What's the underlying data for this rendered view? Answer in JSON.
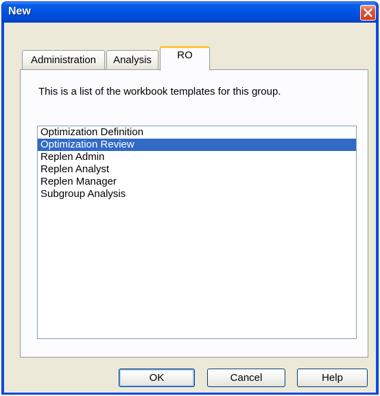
{
  "window": {
    "title": "New",
    "close_icon": "close-icon"
  },
  "tabs": [
    {
      "label": "Administration",
      "selected": false
    },
    {
      "label": "Analysis",
      "selected": false
    },
    {
      "label": "RO",
      "selected": true
    }
  ],
  "panel": {
    "description": "This is a list of the workbook templates for this group.",
    "templates": [
      {
        "label": "Optimization Definition",
        "selected": false
      },
      {
        "label": "Optimization Review",
        "selected": true
      },
      {
        "label": "Replen Admin",
        "selected": false
      },
      {
        "label": "Replen Analyst",
        "selected": false
      },
      {
        "label": "Replen Manager",
        "selected": false
      },
      {
        "label": "Subgroup Analysis",
        "selected": false
      }
    ]
  },
  "buttons": {
    "ok": "OK",
    "cancel": "Cancel",
    "help": "Help"
  },
  "colors": {
    "titlebar": "#0054e3",
    "selection": "#316ac5",
    "active_tab_accent": "#ffc83c",
    "dialog_bg": "#ece9d8"
  }
}
